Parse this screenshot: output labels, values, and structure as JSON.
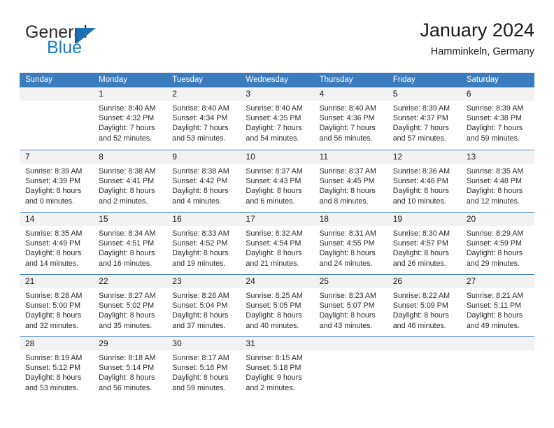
{
  "brand": {
    "name_part1": "General",
    "name_part2": "Blue",
    "accent_color": "#1a7bc4"
  },
  "header": {
    "title": "January 2024",
    "subtitle": "Hamminkeln, Germany"
  },
  "calendar": {
    "header_bg": "#3b7cbf",
    "daynum_bg": "#f2f2f2",
    "weekdays": [
      "Sunday",
      "Monday",
      "Tuesday",
      "Wednesday",
      "Thursday",
      "Friday",
      "Saturday"
    ],
    "weeks": [
      [
        {
          "day": "",
          "sunrise": "",
          "sunset": "",
          "daylight1": "",
          "daylight2": ""
        },
        {
          "day": "1",
          "sunrise": "Sunrise: 8:40 AM",
          "sunset": "Sunset: 4:32 PM",
          "daylight1": "Daylight: 7 hours",
          "daylight2": "and 52 minutes."
        },
        {
          "day": "2",
          "sunrise": "Sunrise: 8:40 AM",
          "sunset": "Sunset: 4:34 PM",
          "daylight1": "Daylight: 7 hours",
          "daylight2": "and 53 minutes."
        },
        {
          "day": "3",
          "sunrise": "Sunrise: 8:40 AM",
          "sunset": "Sunset: 4:35 PM",
          "daylight1": "Daylight: 7 hours",
          "daylight2": "and 54 minutes."
        },
        {
          "day": "4",
          "sunrise": "Sunrise: 8:40 AM",
          "sunset": "Sunset: 4:36 PM",
          "daylight1": "Daylight: 7 hours",
          "daylight2": "and 56 minutes."
        },
        {
          "day": "5",
          "sunrise": "Sunrise: 8:39 AM",
          "sunset": "Sunset: 4:37 PM",
          "daylight1": "Daylight: 7 hours",
          "daylight2": "and 57 minutes."
        },
        {
          "day": "6",
          "sunrise": "Sunrise: 8:39 AM",
          "sunset": "Sunset: 4:38 PM",
          "daylight1": "Daylight: 7 hours",
          "daylight2": "and 59 minutes."
        }
      ],
      [
        {
          "day": "7",
          "sunrise": "Sunrise: 8:39 AM",
          "sunset": "Sunset: 4:39 PM",
          "daylight1": "Daylight: 8 hours",
          "daylight2": "and 0 minutes."
        },
        {
          "day": "8",
          "sunrise": "Sunrise: 8:38 AM",
          "sunset": "Sunset: 4:41 PM",
          "daylight1": "Daylight: 8 hours",
          "daylight2": "and 2 minutes."
        },
        {
          "day": "9",
          "sunrise": "Sunrise: 8:38 AM",
          "sunset": "Sunset: 4:42 PM",
          "daylight1": "Daylight: 8 hours",
          "daylight2": "and 4 minutes."
        },
        {
          "day": "10",
          "sunrise": "Sunrise: 8:37 AM",
          "sunset": "Sunset: 4:43 PM",
          "daylight1": "Daylight: 8 hours",
          "daylight2": "and 6 minutes."
        },
        {
          "day": "11",
          "sunrise": "Sunrise: 8:37 AM",
          "sunset": "Sunset: 4:45 PM",
          "daylight1": "Daylight: 8 hours",
          "daylight2": "and 8 minutes."
        },
        {
          "day": "12",
          "sunrise": "Sunrise: 8:36 AM",
          "sunset": "Sunset: 4:46 PM",
          "daylight1": "Daylight: 8 hours",
          "daylight2": "and 10 minutes."
        },
        {
          "day": "13",
          "sunrise": "Sunrise: 8:35 AM",
          "sunset": "Sunset: 4:48 PM",
          "daylight1": "Daylight: 8 hours",
          "daylight2": "and 12 minutes."
        }
      ],
      [
        {
          "day": "14",
          "sunrise": "Sunrise: 8:35 AM",
          "sunset": "Sunset: 4:49 PM",
          "daylight1": "Daylight: 8 hours",
          "daylight2": "and 14 minutes."
        },
        {
          "day": "15",
          "sunrise": "Sunrise: 8:34 AM",
          "sunset": "Sunset: 4:51 PM",
          "daylight1": "Daylight: 8 hours",
          "daylight2": "and 16 minutes."
        },
        {
          "day": "16",
          "sunrise": "Sunrise: 8:33 AM",
          "sunset": "Sunset: 4:52 PM",
          "daylight1": "Daylight: 8 hours",
          "daylight2": "and 19 minutes."
        },
        {
          "day": "17",
          "sunrise": "Sunrise: 8:32 AM",
          "sunset": "Sunset: 4:54 PM",
          "daylight1": "Daylight: 8 hours",
          "daylight2": "and 21 minutes."
        },
        {
          "day": "18",
          "sunrise": "Sunrise: 8:31 AM",
          "sunset": "Sunset: 4:55 PM",
          "daylight1": "Daylight: 8 hours",
          "daylight2": "and 24 minutes."
        },
        {
          "day": "19",
          "sunrise": "Sunrise: 8:30 AM",
          "sunset": "Sunset: 4:57 PM",
          "daylight1": "Daylight: 8 hours",
          "daylight2": "and 26 minutes."
        },
        {
          "day": "20",
          "sunrise": "Sunrise: 8:29 AM",
          "sunset": "Sunset: 4:59 PM",
          "daylight1": "Daylight: 8 hours",
          "daylight2": "and 29 minutes."
        }
      ],
      [
        {
          "day": "21",
          "sunrise": "Sunrise: 8:28 AM",
          "sunset": "Sunset: 5:00 PM",
          "daylight1": "Daylight: 8 hours",
          "daylight2": "and 32 minutes."
        },
        {
          "day": "22",
          "sunrise": "Sunrise: 8:27 AM",
          "sunset": "Sunset: 5:02 PM",
          "daylight1": "Daylight: 8 hours",
          "daylight2": "and 35 minutes."
        },
        {
          "day": "23",
          "sunrise": "Sunrise: 8:26 AM",
          "sunset": "Sunset: 5:04 PM",
          "daylight1": "Daylight: 8 hours",
          "daylight2": "and 37 minutes."
        },
        {
          "day": "24",
          "sunrise": "Sunrise: 8:25 AM",
          "sunset": "Sunset: 5:05 PM",
          "daylight1": "Daylight: 8 hours",
          "daylight2": "and 40 minutes."
        },
        {
          "day": "25",
          "sunrise": "Sunrise: 8:23 AM",
          "sunset": "Sunset: 5:07 PM",
          "daylight1": "Daylight: 8 hours",
          "daylight2": "and 43 minutes."
        },
        {
          "day": "26",
          "sunrise": "Sunrise: 8:22 AM",
          "sunset": "Sunset: 5:09 PM",
          "daylight1": "Daylight: 8 hours",
          "daylight2": "and 46 minutes."
        },
        {
          "day": "27",
          "sunrise": "Sunrise: 8:21 AM",
          "sunset": "Sunset: 5:11 PM",
          "daylight1": "Daylight: 8 hours",
          "daylight2": "and 49 minutes."
        }
      ],
      [
        {
          "day": "28",
          "sunrise": "Sunrise: 8:19 AM",
          "sunset": "Sunset: 5:12 PM",
          "daylight1": "Daylight: 8 hours",
          "daylight2": "and 53 minutes."
        },
        {
          "day": "29",
          "sunrise": "Sunrise: 8:18 AM",
          "sunset": "Sunset: 5:14 PM",
          "daylight1": "Daylight: 8 hours",
          "daylight2": "and 56 minutes."
        },
        {
          "day": "30",
          "sunrise": "Sunrise: 8:17 AM",
          "sunset": "Sunset: 5:16 PM",
          "daylight1": "Daylight: 8 hours",
          "daylight2": "and 59 minutes."
        },
        {
          "day": "31",
          "sunrise": "Sunrise: 8:15 AM",
          "sunset": "Sunset: 5:18 PM",
          "daylight1": "Daylight: 9 hours",
          "daylight2": "and 2 minutes."
        },
        {
          "day": "",
          "sunrise": "",
          "sunset": "",
          "daylight1": "",
          "daylight2": ""
        },
        {
          "day": "",
          "sunrise": "",
          "sunset": "",
          "daylight1": "",
          "daylight2": ""
        },
        {
          "day": "",
          "sunrise": "",
          "sunset": "",
          "daylight1": "",
          "daylight2": ""
        }
      ]
    ]
  }
}
